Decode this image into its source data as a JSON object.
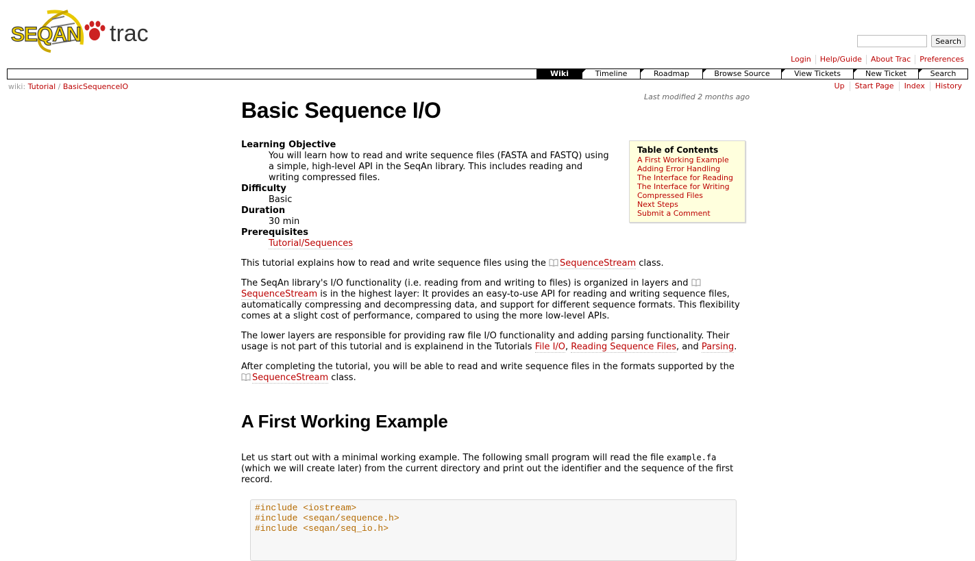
{
  "logo": {
    "brand": "SEQAN",
    "product": "trac"
  },
  "search": {
    "placeholder": "",
    "button_label": "Search"
  },
  "metanav": [
    "Login",
    "Help/Guide",
    "About Trac",
    "Preferences"
  ],
  "mainnav": {
    "active": "Wiki",
    "tabs": [
      "Wiki",
      "Timeline",
      "Roadmap",
      "Browse Source",
      "View Tickets",
      "New Ticket",
      "Search"
    ]
  },
  "ctxnav": [
    "Up",
    "Start Page",
    "Index",
    "History"
  ],
  "breadcrumb": {
    "prefix": "wiki:",
    "parent": "Tutorial",
    "separator": "/",
    "current": "BasicSequenceIO"
  },
  "last_modified": "Last modified 2 months ago",
  "page_title": "Basic Sequence I/O",
  "toc": {
    "title": "Table of Contents",
    "items": [
      "A First Working Example",
      "Adding Error Handling",
      "The Interface for Reading",
      "The Interface for Writing",
      "Compressed Files",
      "Next Steps",
      "Submit a Comment"
    ]
  },
  "meta": {
    "objective_term": "Learning Objective",
    "objective_text": "You will learn how to read and write sequence files (FASTA and FASTQ) using a simple, high-level API in the SeqAn library. This includes reading and writing compressed files.",
    "difficulty_term": "Difficulty",
    "difficulty_text": "Basic",
    "duration_term": "Duration",
    "duration_text": "30 min",
    "prereq_term": "Prerequisites",
    "prereq_link": "Tutorial/Sequences"
  },
  "paragraphs": {
    "p1_a": "This tutorial explains how to read and write sequence files using the ",
    "p1_link": "SequenceStream",
    "p1_b": " class.",
    "p2_a": "The SeqAn library's I/O functionality (i.e. reading from and writing to files) is organized in layers and ",
    "p2_link": "SequenceStream",
    "p2_b": " is in the highest layer: It provides an easy-to-use API for reading and writing sequence files, automatically compressing and decompressing data, and support for different sequence formats. This flexibility comes at a slight cost of performance, compared to using the more low-level APIs.",
    "p3_a": "The lower layers are responsible for providing raw file I/O functionality and adding parsing functionality. Their usage is not part of this tutorial and is explainend in the Tutorials ",
    "p3_link1": "File I/O",
    "p3_sep1": ", ",
    "p3_link2": "Reading Sequence Files",
    "p3_sep2": ", and ",
    "p3_link3": "Parsing",
    "p3_end": ".",
    "p4_a": "After completing the tutorial, you will be able to read and write sequence files in the formats supported by the ",
    "p4_link": "SequenceStream",
    "p4_b": " class."
  },
  "section1": {
    "heading": "A First Working Example",
    "intro_a": "Let us start out with a minimal working example. The following small program will read the file ",
    "intro_code": "example.fa",
    "intro_b": " (which we will create later) from the current directory and print out the identifier and the sequence of the first record.",
    "code_lines": [
      "#include <iostream>",
      "#include <seqan/sequence.h>",
      "#include <seqan/seq_io.h>"
    ]
  },
  "colors": {
    "link": "#bb0000",
    "toc_bg": "#ffffdd",
    "code_text": "#b46a00",
    "nav_active_bg": "#000000"
  }
}
